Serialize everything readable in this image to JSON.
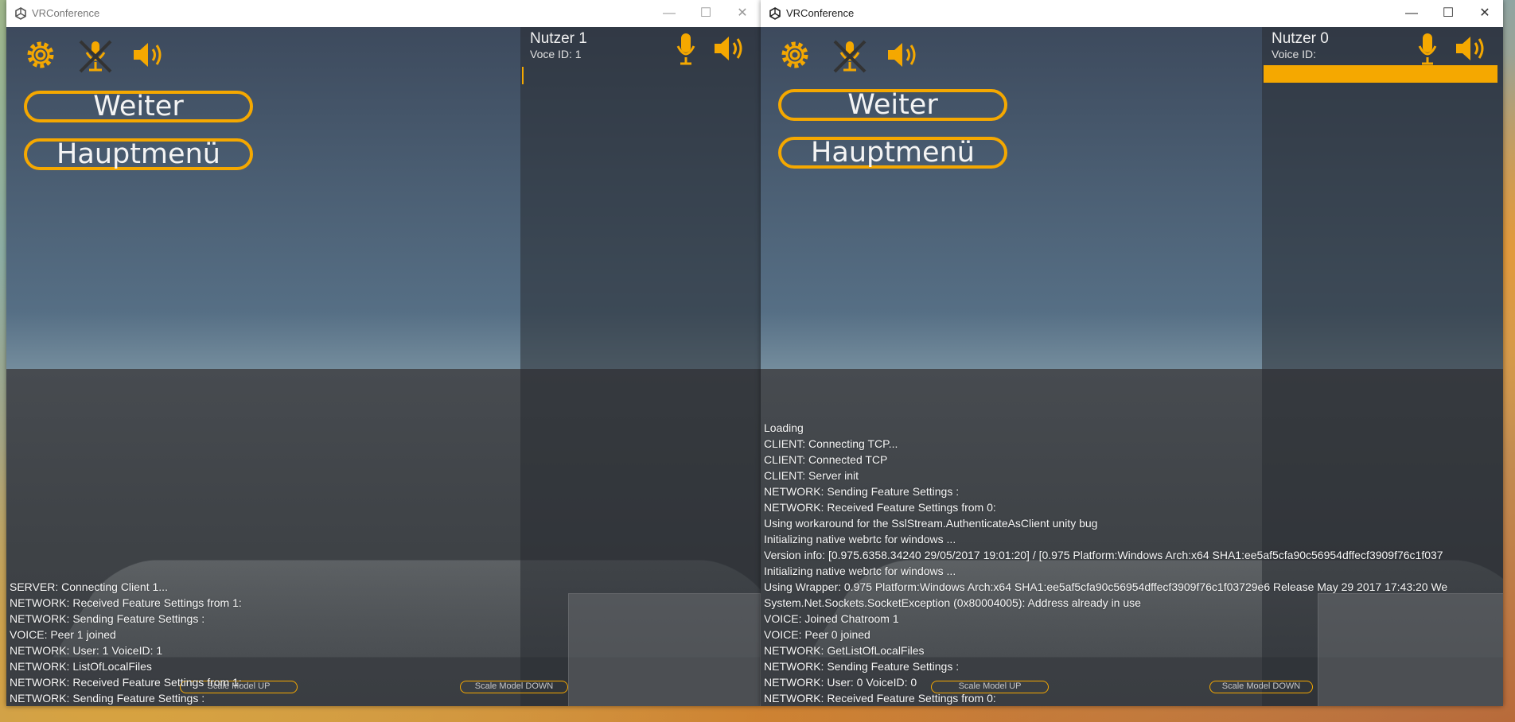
{
  "colors": {
    "accent": "#f5a800",
    "panel": "#2c3036",
    "sky_top": "#3d4a5d"
  },
  "windows": [
    {
      "title": "VRConference",
      "user_name": "Nutzer 1",
      "voice_id": "Voce ID: 1",
      "menu": {
        "continue": "Weiter",
        "main_menu": "Hauptmenü"
      },
      "scale_up": "Scale Model UP",
      "scale_down": "Scale Model DOWN",
      "log": [
        "SERVER: Connecting Client 1...",
        "NETWORK: Received Feature Settings from 1:",
        "NETWORK: Sending Feature Settings :",
        "VOICE: Peer 1 joined",
        "NETWORK: User: 1 VoiceID: 1",
        "NETWORK: ListOfLocalFiles",
        "NETWORK: Received Feature Settings from 1:",
        "NETWORK: Sending Feature Settings :"
      ]
    },
    {
      "title": "VRConference",
      "user_name": "Nutzer 0",
      "voice_id": "Voice ID:",
      "menu": {
        "continue": "Weiter",
        "main_menu": "Hauptmenü"
      },
      "scale_up": "Scale Model UP",
      "scale_down": "Scale Model DOWN",
      "log": [
        "Loading",
        "CLIENT: Connecting TCP...",
        "CLIENT: Connected TCP",
        "CLIENT: Server init",
        "NETWORK: Sending Feature Settings :",
        "NETWORK: Received Feature Settings from 0:",
        "Using workaround for the SslStream.AuthenticateAsClient unity bug",
        "Initializing native webrtc for windows ...",
        "Version info: [0.975.6358.34240 29/05/2017 19:01:20] / [0.975 Platform:Windows Arch:x64 SHA1:ee5af5cfa90c56954dffecf3909f76c1f037",
        "Initializing native webrtc for windows ...",
        "Using Wrapper: 0.975 Platform:Windows Arch:x64 SHA1:ee5af5cfa90c56954dffecf3909f76c1f03729e6 Release May 29 2017 17:43:20 We",
        "System.Net.Sockets.SocketException (0x80004005): Address already in use",
        "VOICE: Joined Chatroom 1",
        "VOICE: Peer 0 joined",
        "NETWORK: GetListOfLocalFiles",
        "NETWORK: Sending Feature Settings :",
        "NETWORK: User: 0 VoiceID: 0",
        "NETWORK: Received Feature Settings from 0:"
      ]
    }
  ],
  "icons": [
    "gear-icon",
    "muted-microphone-icon",
    "speaker-icon",
    "microphone-icon",
    "unity-logo-icon"
  ]
}
